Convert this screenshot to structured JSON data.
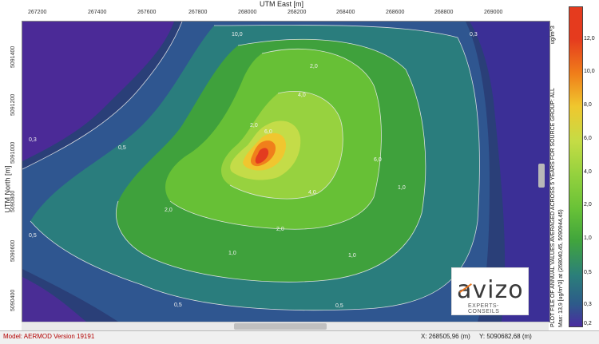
{
  "axes": {
    "top_title": "UTM East [m]",
    "left_title": "UTM North [m]",
    "x_ticks": [
      "267200",
      "267400",
      "267600",
      "267800",
      "268000",
      "268200",
      "268400",
      "268600",
      "268800",
      "269000"
    ],
    "y_ticks": [
      "5091400",
      "5091200",
      "5091000",
      "5090800",
      "5090600",
      "5090400"
    ]
  },
  "contours": {
    "labels": [
      "12,0",
      "10,0",
      "8,0",
      "6,0",
      "4,0",
      "2,0",
      "1,0",
      "0,5",
      "0,3"
    ],
    "colors": {
      "c12": "#e53b1e",
      "c10": "#f07f1a",
      "c8": "#f0c72e",
      "c6": "#c5dc45",
      "c4": "#96d23e",
      "c2": "#69c237",
      "c1": "#41a53c",
      "c05": "#2b7f7a",
      "c03": "#2d5b8a",
      "cmin": "#4a2ca0"
    }
  },
  "legend": {
    "unit": "ug/m^3",
    "plot_title": "PLOT FILE OF ANNUAL VALUES AVERAGED ACROSS 5 YEARS FOR SOURCE GROUP: ALL",
    "max_line": "Max: 13,9 [ug/m^3] at (268040,45, 5090944,45)",
    "ticks": [
      "12,0",
      "10,0",
      "8,0",
      "6,0",
      "4,0",
      "2,0",
      "1,0",
      "0,5",
      "0,3",
      "0,2"
    ]
  },
  "status": {
    "model": "Model: AERMOD Version 19191",
    "x": "X: 268505,96 (m)",
    "y": "Y: 5090682,68 (m)"
  },
  "logo": {
    "name": "avizo",
    "sub": "EXPERTS-CONSEILS"
  }
}
